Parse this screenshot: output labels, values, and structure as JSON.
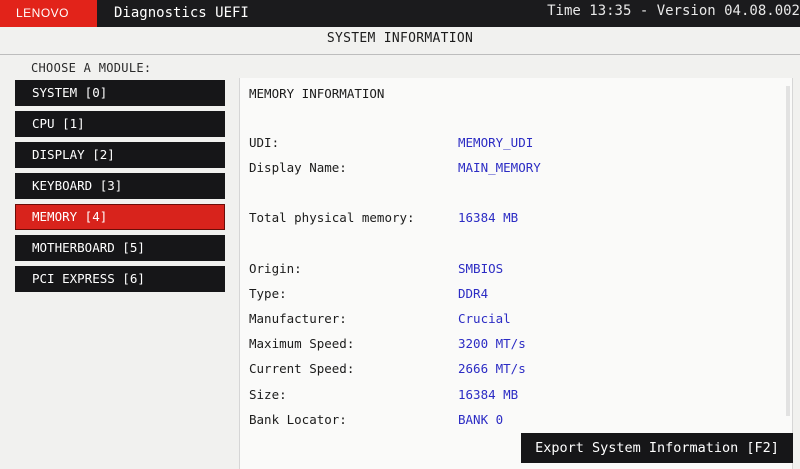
{
  "header": {
    "brand": "LENOVO",
    "app_title": "Diagnostics UEFI",
    "status": "Time 13:35 - Version 04.08.002"
  },
  "page_title": "SYSTEM INFORMATION",
  "choose_label": "CHOOSE A MODULE:",
  "modules": [
    {
      "label": "SYSTEM [0]",
      "active": false
    },
    {
      "label": "CPU [1]",
      "active": false
    },
    {
      "label": "DISPLAY [2]",
      "active": false
    },
    {
      "label": "KEYBOARD [3]",
      "active": false
    },
    {
      "label": "MEMORY [4]",
      "active": true
    },
    {
      "label": "MOTHERBOARD [5]",
      "active": false
    },
    {
      "label": "PCI EXPRESS [6]",
      "active": false
    }
  ],
  "memory_info": {
    "title": "MEMORY INFORMATION",
    "rows": [
      {
        "label": "UDI:",
        "value": "MEMORY_UDI"
      },
      {
        "label": "Display Name:",
        "value": "MAIN_MEMORY"
      },
      {
        "label": "Total physical memory:",
        "value": "16384 MB"
      },
      {
        "label": "Origin:",
        "value": "SMBIOS"
      },
      {
        "label": "Type:",
        "value": "DDR4"
      },
      {
        "label": "Manufacturer:",
        "value": "Crucial"
      },
      {
        "label": "Maximum Speed:",
        "value": "3200 MT/s"
      },
      {
        "label": "Current Speed:",
        "value": "2666 MT/s"
      },
      {
        "label": "Size:",
        "value": "16384 MB"
      },
      {
        "label": "Bank Locator:",
        "value": "BANK 0"
      }
    ]
  },
  "export_label": "Export System Information [F2]",
  "colors": {
    "brand_red": "#e2231a",
    "active_module": "#d8231c",
    "value_blue": "#2c2cc4",
    "dark": "#161618"
  }
}
